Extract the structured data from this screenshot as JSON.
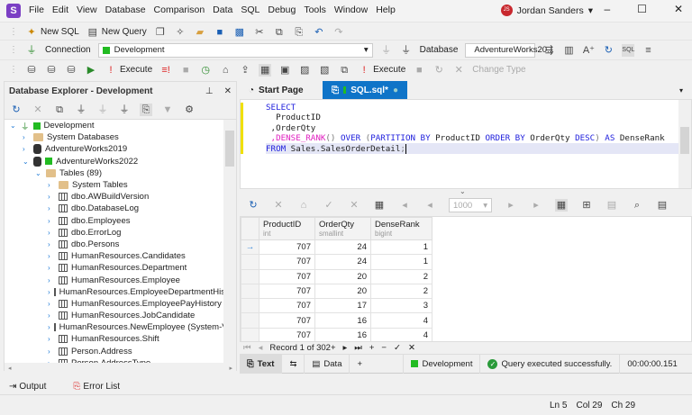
{
  "app": {
    "logo": "S",
    "menu": [
      "File",
      "Edit",
      "View",
      "Database",
      "Comparison",
      "Data",
      "SQL",
      "Debug",
      "Tools",
      "Window",
      "Help"
    ],
    "user_initials": "JS",
    "user_name": "Jordan Sanders"
  },
  "toolbar1": {
    "new_sql": "New SQL",
    "new_query": "New Query"
  },
  "toolbar2": {
    "connection_label": "Connection",
    "connection_value": "Development",
    "database_label": "Database",
    "database_value": "AdventureWorks20..."
  },
  "toolbar3": {
    "execute": "Execute",
    "execute2": "Execute",
    "change_type": "Change Type"
  },
  "explorer": {
    "title": "Database Explorer - Development",
    "tree": [
      {
        "label": "Development",
        "level": 0,
        "icon": "connection",
        "expanded": true
      },
      {
        "label": "System Databases",
        "level": 1,
        "icon": "folder"
      },
      {
        "label": "AdventureWorks2019",
        "level": 1,
        "icon": "database"
      },
      {
        "label": "AdventureWorks2022",
        "level": 1,
        "icon": "database",
        "expanded": true
      },
      {
        "label": "Tables (89)",
        "level": 2,
        "icon": "folder-open",
        "expanded": true
      },
      {
        "label": "System Tables",
        "level": 3,
        "icon": "folder"
      },
      {
        "label": "dbo.AWBuildVersion",
        "level": 3,
        "icon": "table"
      },
      {
        "label": "dbo.DatabaseLog",
        "level": 3,
        "icon": "table"
      },
      {
        "label": "dbo.Employees",
        "level": 3,
        "icon": "table"
      },
      {
        "label": "dbo.ErrorLog",
        "level": 3,
        "icon": "table"
      },
      {
        "label": "dbo.Persons",
        "level": 3,
        "icon": "table"
      },
      {
        "label": "HumanResources.Candidates",
        "level": 3,
        "icon": "table"
      },
      {
        "label": "HumanResources.Department",
        "level": 3,
        "icon": "table"
      },
      {
        "label": "HumanResources.Employee",
        "level": 3,
        "icon": "table"
      },
      {
        "label": "HumanResources.EmployeeDepartmentHistory",
        "level": 3,
        "icon": "table"
      },
      {
        "label": "HumanResources.EmployeePayHistory",
        "level": 3,
        "icon": "table"
      },
      {
        "label": "HumanResources.JobCandidate",
        "level": 3,
        "icon": "table"
      },
      {
        "label": "HumanResources.NewEmployee (System-Versioned)",
        "level": 3,
        "icon": "table"
      },
      {
        "label": "HumanResources.Shift",
        "level": 3,
        "icon": "table"
      },
      {
        "label": "Person.Address",
        "level": 3,
        "icon": "table"
      },
      {
        "label": "Person.AddressType",
        "level": 3,
        "icon": "table"
      }
    ]
  },
  "bottom_tabs": {
    "output": "Output",
    "error_list": "Error List"
  },
  "tabs": {
    "start_page": "Start Page",
    "sql": "SQL.sql*"
  },
  "editor": {
    "lines": {
      "l1": "SELECT",
      "l2": "  ProductID",
      "l3": " ,OrderQty",
      "l4_fn": " ,DENSE_RANK",
      "l4_rest": "() ",
      "l4_over": "OVER ",
      "l4_p1": "(",
      "l4_part": "PARTITION BY ",
      "l4_col": "ProductID ",
      "l4_order": "ORDER BY ",
      "l4_col2": "OrderQty ",
      "l4_desc": "DESC",
      "l4_p2": ") ",
      "l4_as": "AS ",
      "l4_alias": "DenseRank",
      "l5_from": "FROM ",
      "l5_rest": "Sales.SalesOrderDetail",
      "l5_semi": ";"
    }
  },
  "grid": {
    "page_size": "1000",
    "columns": [
      {
        "name": "ProductID",
        "type": "int"
      },
      {
        "name": "OrderQty",
        "type": "smallint"
      },
      {
        "name": "DenseRank",
        "type": "bigint"
      }
    ],
    "rows": [
      [
        "707",
        "24",
        "1"
      ],
      [
        "707",
        "24",
        "1"
      ],
      [
        "707",
        "20",
        "2"
      ],
      [
        "707",
        "20",
        "2"
      ],
      [
        "707",
        "17",
        "3"
      ],
      [
        "707",
        "16",
        "4"
      ],
      [
        "707",
        "16",
        "4"
      ]
    ],
    "record_nav": "Record 1 of 302+"
  },
  "result_tabs": {
    "text": "Text",
    "data": "Data",
    "connection": "Development",
    "status": "Query executed successfully.",
    "elapsed": "00:00:00.151"
  },
  "statusbar": {
    "ln": "Ln 5",
    "col": "Col 29",
    "ch": "Ch 29"
  }
}
